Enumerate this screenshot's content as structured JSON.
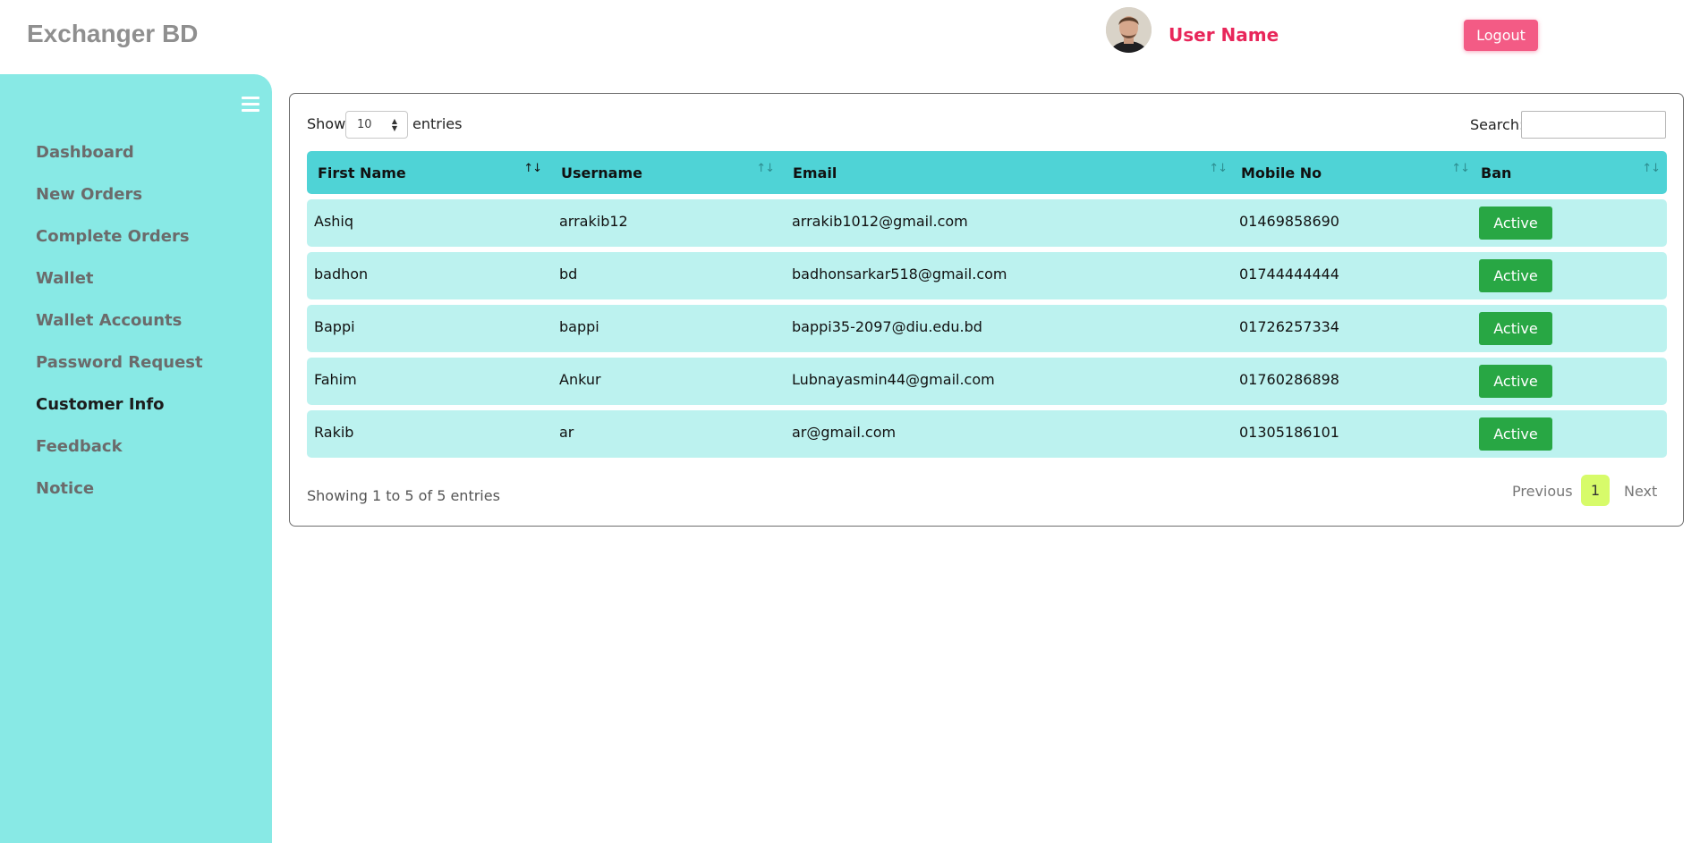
{
  "header": {
    "brand": "Exchanger BD",
    "user_name": "User Name",
    "logout_label": "Logout"
  },
  "sidebar": {
    "toggle_icon": "hamburger-menu-icon",
    "items": [
      {
        "label": "Dashboard",
        "active": false
      },
      {
        "label": "New Orders",
        "active": false
      },
      {
        "label": "Complete Orders",
        "active": false
      },
      {
        "label": "Wallet",
        "active": false
      },
      {
        "label": "Wallet Accounts",
        "active": false
      },
      {
        "label": "Password Request",
        "active": false
      },
      {
        "label": "Customer Info",
        "active": true
      },
      {
        "label": "Feedback",
        "active": false
      },
      {
        "label": "Notice",
        "active": false
      }
    ]
  },
  "table_controls": {
    "show_label": "Show",
    "page_length": "10",
    "entries_label": "entries",
    "search_label": "Search:",
    "search_value": ""
  },
  "table": {
    "columns": [
      "First Name",
      "Username",
      "Email",
      "Mobile No",
      "Ban"
    ],
    "rows": [
      {
        "first_name": "Ashiq",
        "username": "arrakib12",
        "email": "arrakib1012@gmail.com",
        "mobile": "01469858690",
        "ban": "Active"
      },
      {
        "first_name": "badhon",
        "username": "bd",
        "email": "badhonsarkar518@gmail.com",
        "mobile": "01744444444",
        "ban": "Active"
      },
      {
        "first_name": "Bappi",
        "username": "bappi",
        "email": "bappi35-2097@diu.edu.bd",
        "mobile": "01726257334",
        "ban": "Active"
      },
      {
        "first_name": "Fahim",
        "username": "Ankur",
        "email": "Lubnayasmin44@gmail.com",
        "mobile": "01760286898",
        "ban": "Active"
      },
      {
        "first_name": "Rakib",
        "username": "ar",
        "email": "ar@gmail.com",
        "mobile": "01305186101",
        "ban": "Active"
      }
    ],
    "sort_icon": "↑↓"
  },
  "footer": {
    "info": "Showing 1 to 5 of 5 entries",
    "previous": "Previous",
    "current_page": "1",
    "next": "Next"
  },
  "colors": {
    "sidebar_bg": "#88e9e5",
    "table_header_bg": "#4fd3d6",
    "row_bg": "#bcf2ef",
    "ban_button": "#28a744",
    "logout_button": "#f35b85",
    "user_name": "#e8265a",
    "current_page": "#d7fb6a"
  }
}
